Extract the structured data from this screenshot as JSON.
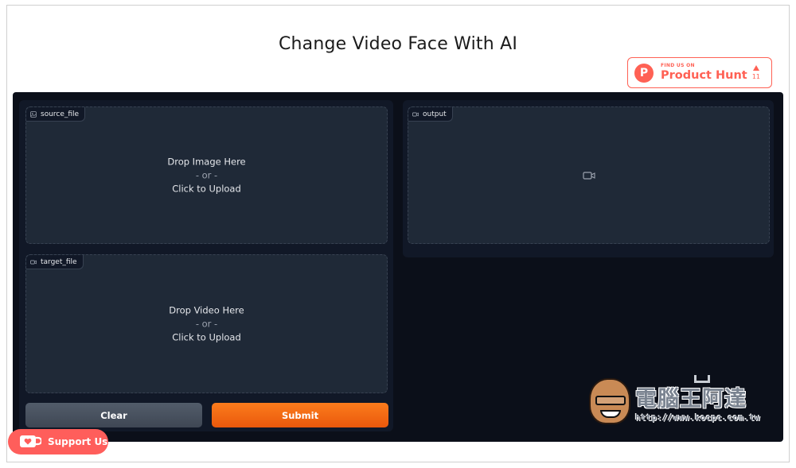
{
  "page": {
    "title": "Change Video Face With AI"
  },
  "product_hunt": {
    "small_text": "FIND US ON",
    "big_text": "Product Hunt",
    "votes": "11",
    "logo_letter": "P"
  },
  "inputs": {
    "source": {
      "label": "source_file",
      "line1": "Drop Image Here",
      "line2": "- or -",
      "line3": "Click to Upload"
    },
    "target": {
      "label": "target_file",
      "line1": "Drop Video Here",
      "line2": "- or -",
      "line3": "Click to Upload"
    }
  },
  "output": {
    "label": "output"
  },
  "buttons": {
    "clear": "Clear",
    "submit": "Submit"
  },
  "support": {
    "label": "Support Us"
  },
  "watermark": {
    "title": "電腦王阿達",
    "url": "http://www.kocpc.com.tw"
  },
  "colors": {
    "app_bg": "#0b0f19",
    "panel_bg": "#1f2937",
    "submit": "#f97316",
    "clear": "#4b5563",
    "product_hunt": "#ff6154",
    "support": "#ff5e5b"
  }
}
